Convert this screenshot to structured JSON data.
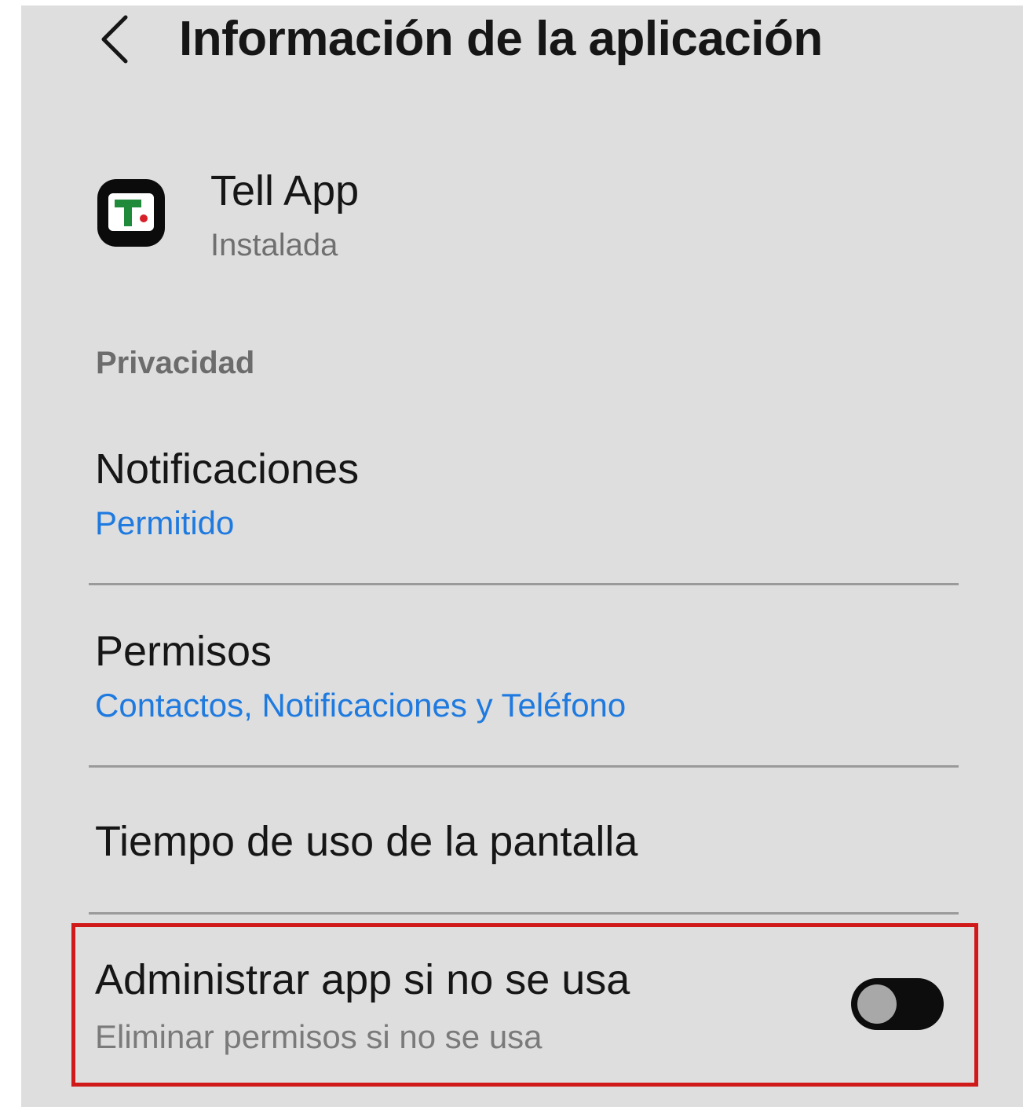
{
  "header": {
    "back_icon": "chevron-left-icon",
    "title": "Información de la aplicación"
  },
  "app": {
    "icon": "tell-app-logo",
    "name": "Tell App",
    "status": "Instalada"
  },
  "privacy": {
    "section_label": "Privacidad",
    "items": [
      {
        "title": "Notificaciones",
        "subtitle": "Permitido"
      },
      {
        "title": "Permisos",
        "subtitle": "Contactos, Notificaciones y Teléfono"
      },
      {
        "title": "Tiempo de uso de la pantalla"
      },
      {
        "title": "Administrar app si no se usa",
        "subtitle": "Eliminar permisos si no se usa",
        "toggle_on": false
      }
    ]
  },
  "colors": {
    "background": "#dedede",
    "accent_link": "#1f7ae0",
    "highlight": "#d01919"
  }
}
